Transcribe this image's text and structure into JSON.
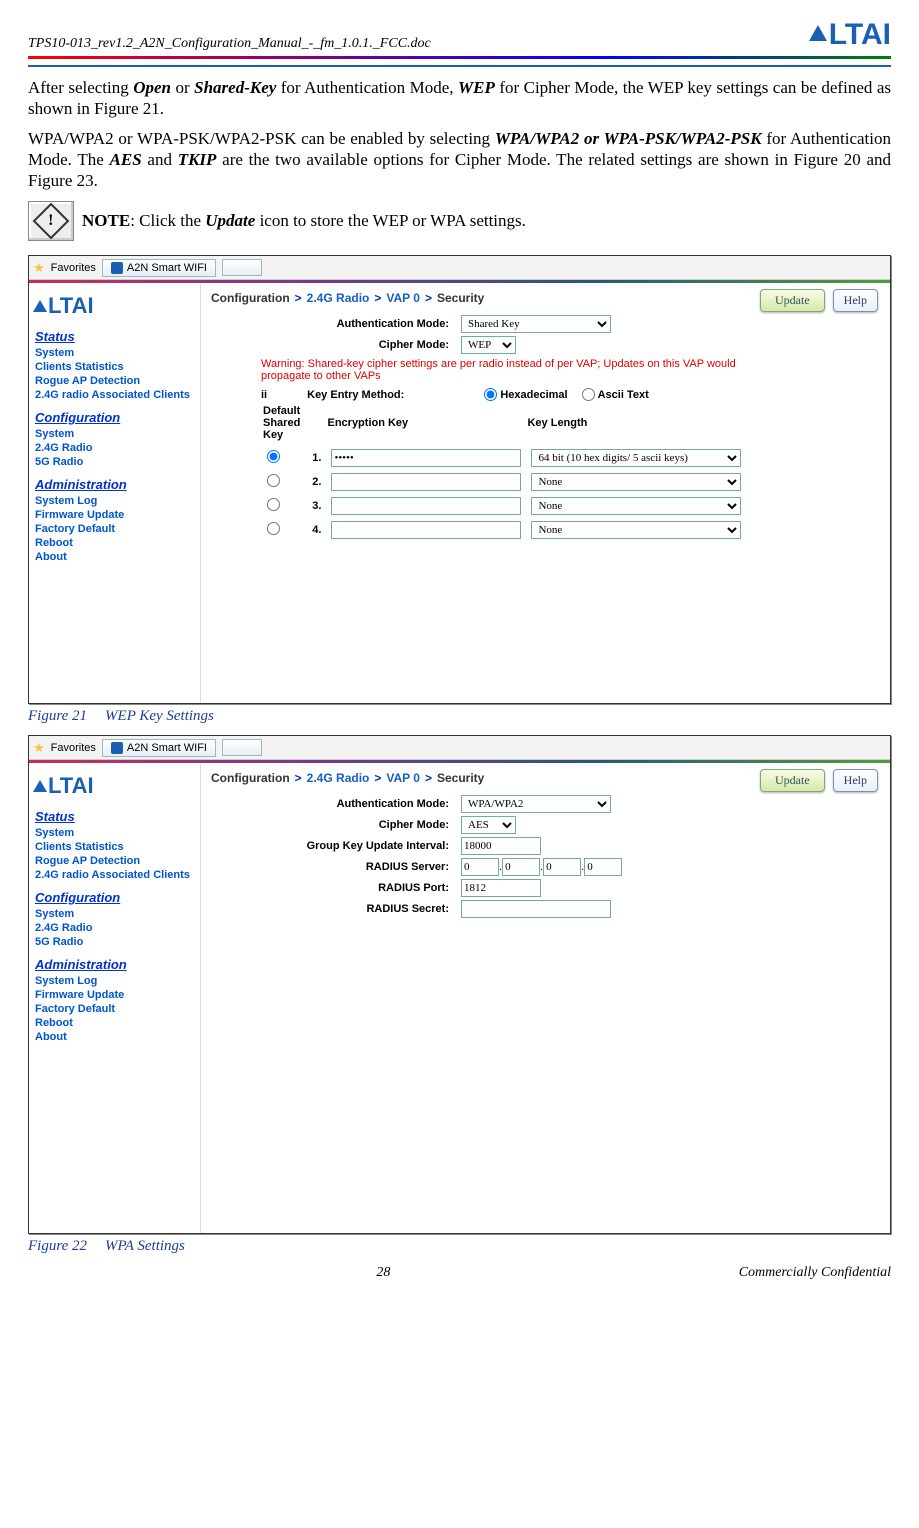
{
  "header": {
    "docname": "TPS10-013_rev1.2_A2N_Configuration_Manual_-_fm_1.0.1._FCC.doc",
    "logo": "ALTAI"
  },
  "para1_a": "After selecting ",
  "para1_b": "Open",
  "para1_c": " or ",
  "para1_d": "Shared-Key",
  "para1_e": " for Authentication Mode, ",
  "para1_f": "WEP",
  "para1_g": " for Cipher Mode, the WEP key settings can be defined as shown in Figure 21.",
  "para2_a": "WPA/WPA2 or WPA-PSK/WPA2-PSK can be enabled by selecting ",
  "para2_b": "WPA/WPA2 or WPA-PSK/WPA2-PSK",
  "para2_c": " for Authentication Mode. The ",
  "para2_d": "AES",
  "para2_e": " and ",
  "para2_f": "TKIP",
  "para2_g": " are the two available options for Cipher Mode. The related settings are shown in Figure 20 and Figure 23.",
  "note_label": "NOTE",
  "note_text": ": Click the ",
  "note_b": "Update",
  "note_after": " icon to store the WEP or WPA settings.",
  "fav_label": "Favorites",
  "tab_title": "A2N Smart WIFI",
  "side_logo": "LTAI",
  "sections": {
    "status": "Status",
    "config": "Configuration",
    "admin": "Administration"
  },
  "nav": {
    "system": "System",
    "clients": "Clients Statistics",
    "rogue": "Rogue AP Detection",
    "assoc": "2.4G radio Associated Clients",
    "r24": "2.4G Radio",
    "r5": "5G Radio",
    "syslog": "System Log",
    "fw": "Firmware Update",
    "factory": "Factory Default",
    "reboot": "Reboot",
    "about": "About"
  },
  "crumb": {
    "c1": "Configuration",
    "c2": "2.4G Radio",
    "c3": "VAP 0",
    "c4": "Security",
    "sep": ">"
  },
  "buttons": {
    "update": "Update",
    "help": "Help"
  },
  "labels": {
    "auth": "Authentication Mode:",
    "cipher": "Cipher Mode:",
    "keymethod_prefix": "ii",
    "keymethod": "Key Entry Method:",
    "hex": "Hexadecimal",
    "ascii": "Ascii Text",
    "defkey_l1": "Default",
    "defkey_l2": "Shared",
    "defkey_l3": "Key",
    "enckey": "Encryption Key",
    "keylen": "Key Length",
    "gkui": "Group Key Update Interval:",
    "rserver": "RADIUS Server:",
    "rport": "RADIUS Port:",
    "rsecret": "RADIUS Secret:"
  },
  "fig1": {
    "auth_val": "Shared Key",
    "cipher_val": "WEP",
    "warning": "Warning: Shared-key cipher settings are per radio instead of per VAP; Updates on this VAP would propagate to other VAPs",
    "rows": [
      {
        "n": "1.",
        "key": "•••••",
        "len": "64 bit (10 hex digits/ 5 ascii keys)",
        "sel": true
      },
      {
        "n": "2.",
        "key": "",
        "len": "None",
        "sel": false
      },
      {
        "n": "3.",
        "key": "",
        "len": "None",
        "sel": false
      },
      {
        "n": "4.",
        "key": "",
        "len": "None",
        "sel": false
      }
    ]
  },
  "fig2": {
    "auth_val": "WPA/WPA2",
    "cipher_val": "AES",
    "gkui_val": "18000",
    "ip": [
      "0",
      "0",
      "0",
      "0"
    ],
    "port_val": "1812",
    "secret_val": ""
  },
  "caption1_a": "Figure 21",
  "caption1_b": "WEP Key Settings",
  "caption2_a": "Figure 22",
  "caption2_b": "WPA Settings",
  "footer": {
    "page": "28",
    "conf": "Commercially Confidential"
  }
}
